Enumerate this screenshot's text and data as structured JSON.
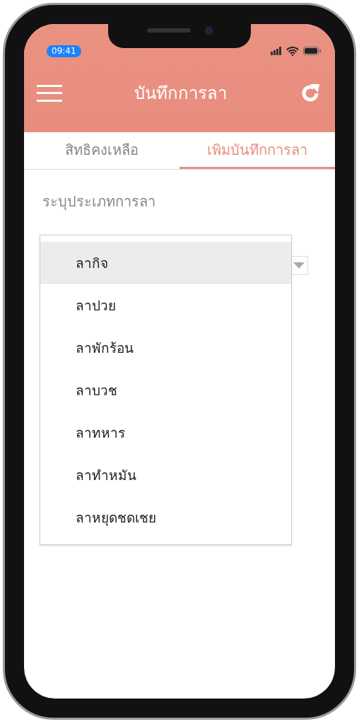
{
  "status_bar": {
    "time": "09:41"
  },
  "header": {
    "title": "บันทึกการลา"
  },
  "tabs": [
    {
      "label": "สิทธิคงเหลือ",
      "selected": false
    },
    {
      "label": "เพิมบันทึกการลา",
      "selected": true
    }
  ],
  "form": {
    "field_label": "ระบุประเภทการลา"
  },
  "dropdown": {
    "options": [
      {
        "label": "ลากิจ",
        "selected": true
      },
      {
        "label": "ลาปวย",
        "selected": false
      },
      {
        "label": "ลาพักร้อน",
        "selected": false
      },
      {
        "label": "ลาบวช",
        "selected": false
      },
      {
        "label": "ลาทหาร",
        "selected": false
      },
      {
        "label": "ลาทำหมัน",
        "selected": false
      },
      {
        "label": "ลาหยุดชดเชย",
        "selected": false
      }
    ]
  }
}
